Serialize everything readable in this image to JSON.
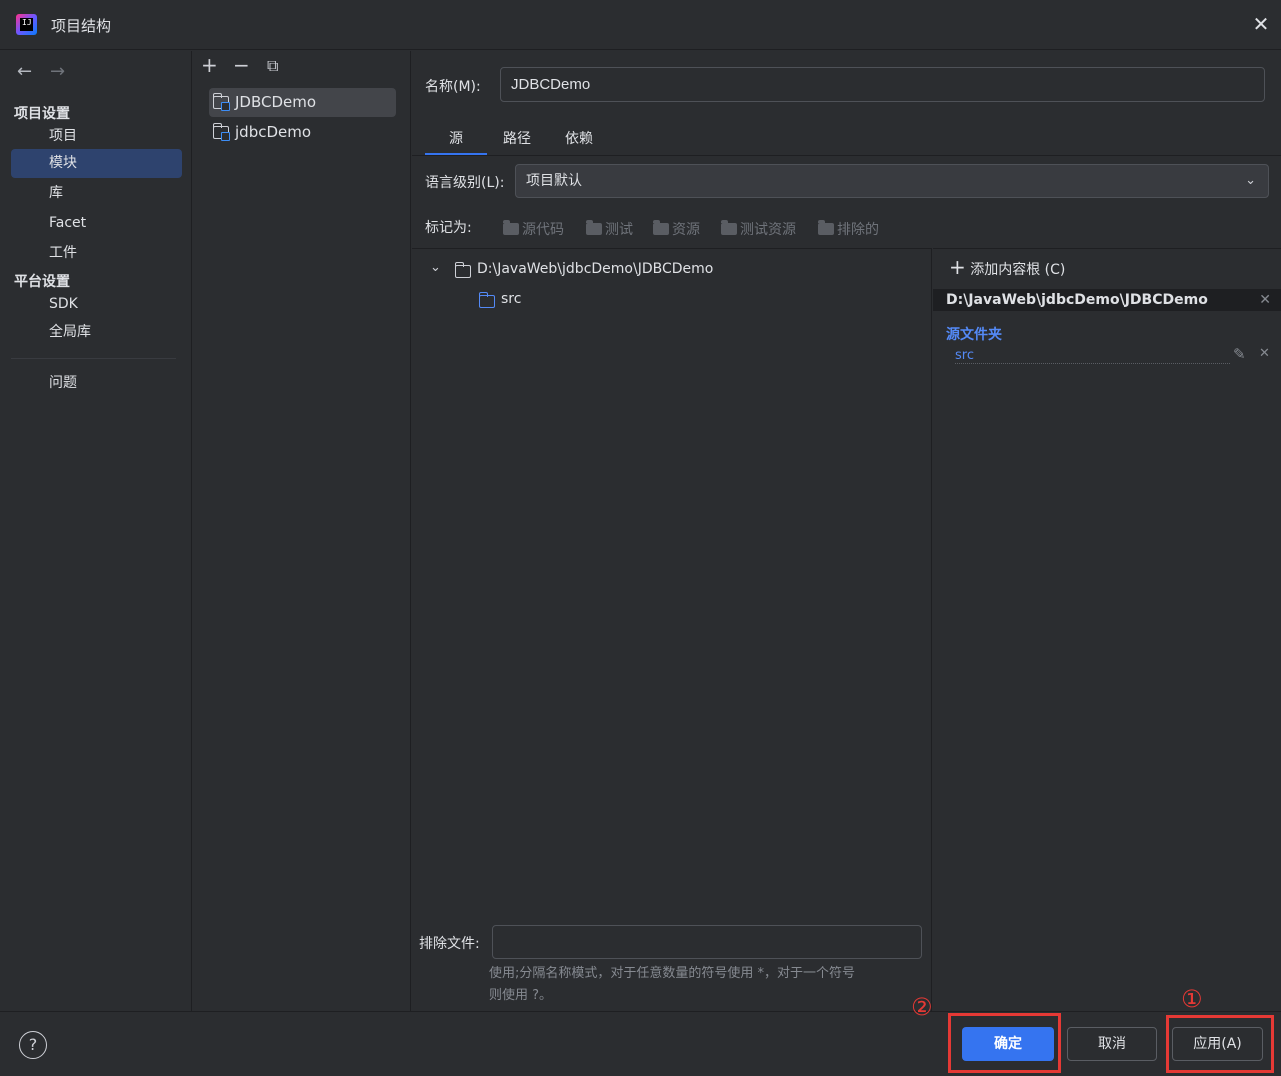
{
  "window": {
    "title": "项目结构",
    "logo_text": "IJ"
  },
  "nav": {
    "back": "←",
    "forward": "→",
    "section_project": "项目设置",
    "items_project": [
      "项目",
      "模块",
      "库",
      "Facet",
      "工件"
    ],
    "section_platform": "平台设置",
    "items_platform": [
      "SDK",
      "全局库"
    ],
    "problems": "问题"
  },
  "modules": {
    "add": "+",
    "remove": "−",
    "copy": "⧉",
    "items": [
      "JDBCDemo",
      "jdbcDemo"
    ]
  },
  "main": {
    "name_label": "名称(M):",
    "name_value": "JDBCDemo",
    "tabs": [
      "源",
      "路径",
      "依赖"
    ],
    "lang_label": "语言级别(L):",
    "lang_value": "项目默认",
    "mark_label": "标记为:",
    "mark_buttons": [
      "源代码",
      "测试",
      "资源",
      "测试资源",
      "排除的"
    ],
    "tree_root": "D:\\JavaWeb\\jdbcDemo\\JDBCDemo",
    "tree_child": "src",
    "add_root": "添加内容根 (C)",
    "root_path": "D:\\JavaWeb\\jdbcDemo\\JDBCDemo",
    "source_folders_title": "源文件夹",
    "source_folder": "src",
    "exclude_label": "排除文件:",
    "exclude_value": "",
    "hint_line1": "使用;分隔名称模式，对于任意数量的符号使用 *，对于一个符号",
    "hint_line2": "则使用 ?。"
  },
  "footer": {
    "help": "?",
    "ok": "确定",
    "cancel": "取消",
    "apply": "应用(A)",
    "marker_1": "①",
    "marker_2": "②"
  },
  "colors": {
    "accent": "#3574f0",
    "annotation": "#e53935",
    "bg": "#2b2d30"
  }
}
